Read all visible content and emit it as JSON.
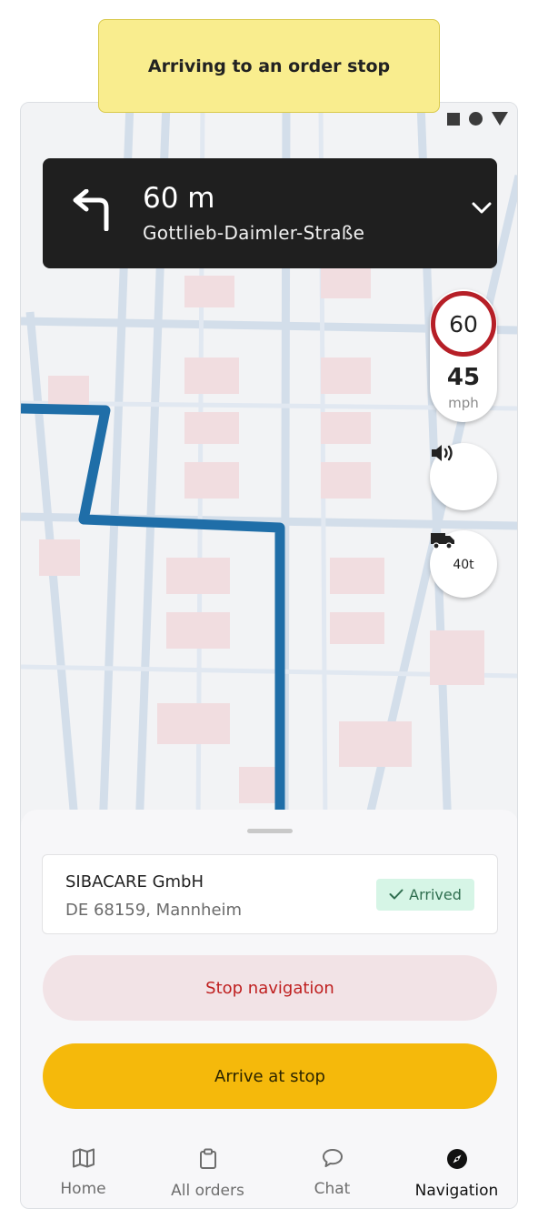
{
  "tooltip": {
    "text": "Arriving to an order stop"
  },
  "navigation_card": {
    "distance": "60 m",
    "street": "Gottlieb-Daimler-Straße"
  },
  "speed": {
    "limit": "60",
    "current": "45",
    "unit": "mph"
  },
  "truck": {
    "weight": "40t"
  },
  "stop": {
    "name": "SIBACARE GmbH",
    "address": "DE 68159, Mannheim",
    "status": "Arrived"
  },
  "actions": {
    "stop_navigation": "Stop navigation",
    "arrive_at_stop": "Arrive at stop"
  },
  "bottom_nav": {
    "items": [
      {
        "label": "Home",
        "icon": "map-icon"
      },
      {
        "label": "All orders",
        "icon": "clipboard-icon"
      },
      {
        "label": "Chat",
        "icon": "chat-icon"
      },
      {
        "label": "Navigation",
        "icon": "compass-icon",
        "active": true
      }
    ]
  },
  "colors": {
    "route": "#1f6ea8",
    "primary_button": "#f5b90b",
    "danger_text": "#bf1f1f",
    "speed_limit_ring": "#b61f27",
    "arrived_badge": "#d6f5e6"
  }
}
